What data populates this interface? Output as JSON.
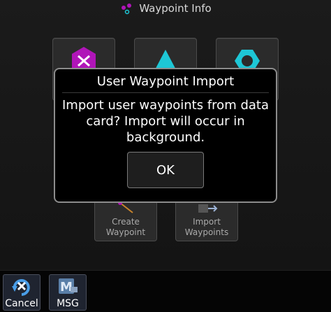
{
  "header": {
    "title": "Waypoint Info",
    "icon": "waypoint-info-icon"
  },
  "tiles": [
    {
      "icon": "user-waypoint-icon",
      "label": "",
      "color": "#b015b8"
    },
    {
      "icon": "airport-triangle-icon",
      "label": "",
      "color": "#1ec7d6"
    },
    {
      "icon": "vor-icon",
      "label": "",
      "color": "#1ec7d6"
    },
    {
      "icon": "create-waypoint-icon",
      "label": "Create Waypoint"
    },
    {
      "icon": "import-waypoints-icon",
      "label": "Import Waypoints"
    }
  ],
  "dialog": {
    "title": "User Waypoint Import",
    "message": "Import user waypoints from data card? Import will occur in background.",
    "ok_label": "OK"
  },
  "softkeys": {
    "cancel": {
      "label": "Cancel",
      "icon": "cancel-icon"
    },
    "msg": {
      "label": "MSG",
      "icon": "msg-icon"
    }
  },
  "colors": {
    "magenta": "#b015b8",
    "cyan": "#1ec7d6",
    "dialog_border": "#8c8c8c"
  }
}
